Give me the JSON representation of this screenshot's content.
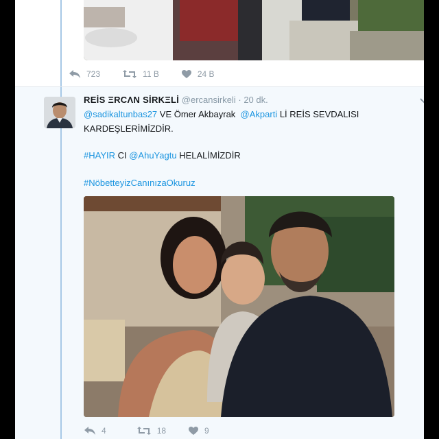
{
  "previous_tweet": {
    "reply_count": "723",
    "retweet_count": "11 B",
    "like_count": "24 B"
  },
  "tweet": {
    "author_name": "REİS ΞRCΛN SİRKΞLİ",
    "author_handle": "@ercansirkeli",
    "separator": "·",
    "time": "20 dk.",
    "line1": {
      "mention1": "@sadikaltunbas27",
      "text1": " VE Ömer Akbayrak  ",
      "mention2": "@Akparti",
      "text2": " Lİ REİS SEVDALISI"
    },
    "line2": "KARDEŞLERİMİZDİR.",
    "line3": {
      "hashtag": "#HAYIR",
      "text1": " CI ",
      "mention": "@AhuYagtu",
      "text2": " HELALİMİZDİR"
    },
    "line4": "#NöbetteyizCanınızaOkuruz",
    "reply_count": "4",
    "retweet_count": "18",
    "like_count": "9"
  },
  "colors": {
    "link": "#1b95e0",
    "thread_line": "#a7c8e6",
    "highlight_bg": "#f4f9fd",
    "action_gray": "#8f9ba6"
  },
  "icons": {
    "reply": "reply-icon",
    "retweet": "retweet-icon",
    "like": "heart-icon",
    "more": "chevron-down-icon"
  }
}
